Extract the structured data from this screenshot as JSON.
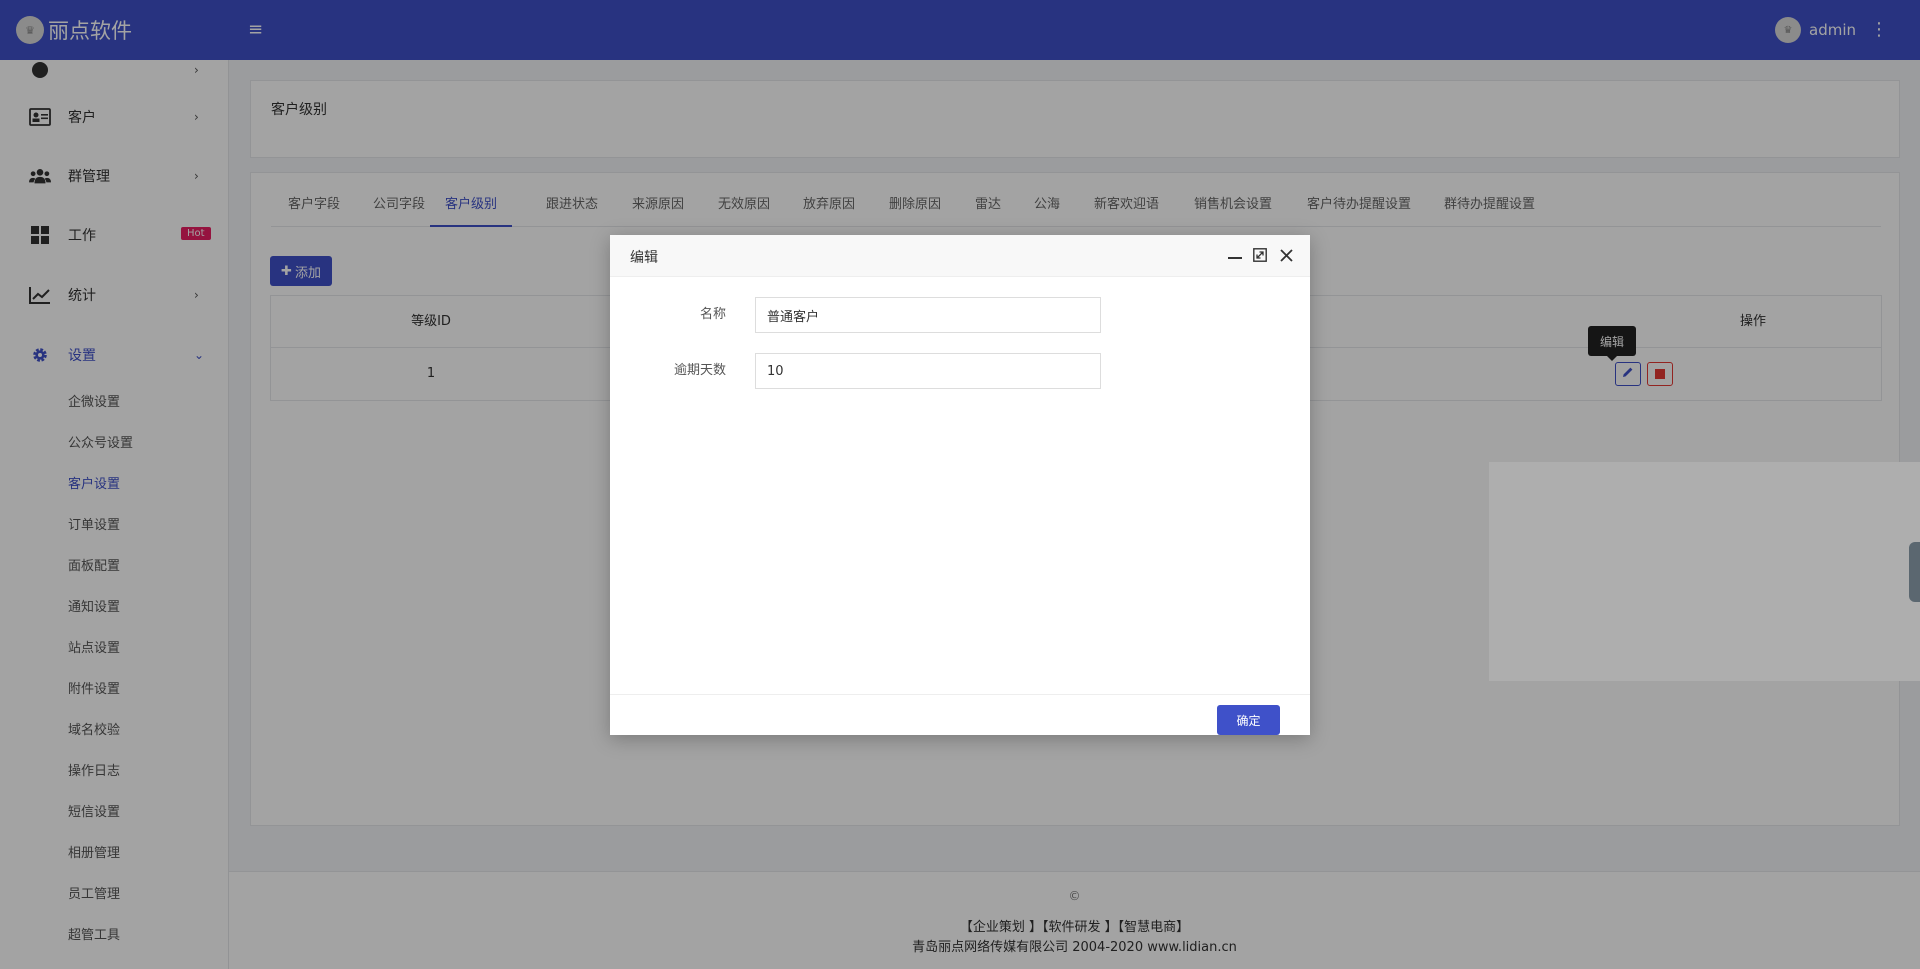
{
  "brand": {
    "logo_text": "♛",
    "name": "丽点软件"
  },
  "topbar": {
    "menu_icon": "menu-icon",
    "user_avatar_text": "♛",
    "user_name": "admin",
    "more_icon": "more-vertical-icon"
  },
  "sidebar": {
    "items": [
      {
        "label": "客户",
        "icon": "id-card-icon"
      },
      {
        "label": "群管理",
        "icon": "users-icon"
      },
      {
        "label": "工作",
        "icon": "grid-icon",
        "badge": "Hot"
      },
      {
        "label": "统计",
        "icon": "chart-line-icon"
      },
      {
        "label": "设置",
        "icon": "gear-icon"
      }
    ],
    "sub_items": [
      "企微设置",
      "公众号设置",
      "客户设置",
      "订单设置",
      "面板配置",
      "通知设置",
      "站点设置",
      "附件设置",
      "域名校验",
      "操作日志",
      "短信设置",
      "相册管理",
      "员工管理",
      "超管工具"
    ],
    "active_sub": "客户设置"
  },
  "page": {
    "title": "客户级别"
  },
  "tabs": [
    "客户字段",
    "公司字段",
    "客户级别",
    "跟进状态",
    "来源原因",
    "无效原因",
    "放弃原因",
    "删除原因",
    "雷达",
    "公海",
    "新客欢迎语",
    "销售机会设置",
    "客户待办提醒设置",
    "群待办提醒设置"
  ],
  "active_tab": "客户级别",
  "toolbar": {
    "add_label": "添加"
  },
  "table": {
    "headers": {
      "id": "等级ID",
      "ops": "操作"
    },
    "rows": [
      {
        "id": "1"
      }
    ],
    "tooltip": "编辑"
  },
  "modal": {
    "title": "编辑",
    "fields": [
      {
        "label": "名称",
        "value": "普通客户"
      },
      {
        "label": "逾期天数",
        "value": "10"
      }
    ],
    "confirm_label": "确定"
  },
  "footer": {
    "copyright": "©",
    "links": "【企业策划 】【软件研发 】【智慧电商】",
    "company": "青岛丽点网络传媒有限公司 2004-2020 www.lidian.cn"
  },
  "colors": {
    "primary": "#3f51c9",
    "danger": "#e53935",
    "hot": "#e91e63"
  }
}
